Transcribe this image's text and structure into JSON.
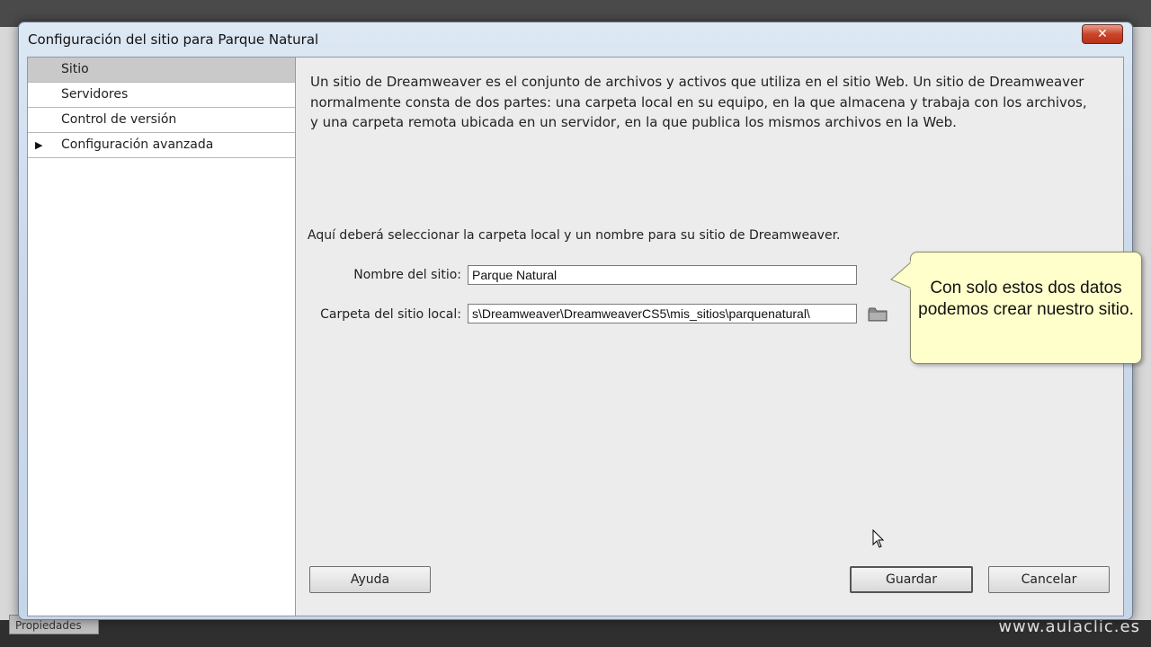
{
  "background": {
    "properties_tab": "Propiedades",
    "watermark": "www.aulaclic.es"
  },
  "dialog": {
    "title": "Configuración del sitio para Parque Natural",
    "close_glyph": "✕"
  },
  "nav": {
    "items": [
      {
        "label": "Sitio",
        "selected": true
      },
      {
        "label": "Servidores"
      },
      {
        "label": "Control de versión"
      },
      {
        "label": "Configuración avanzada",
        "expandable": true
      }
    ],
    "arrow_glyph": "▶"
  },
  "main": {
    "description": "Un sitio de Dreamweaver es el conjunto de archivos y activos que utiliza en el sitio Web. Un sitio de Dreamweaver normalmente consta de dos partes: una carpeta local en su equipo, en la que almacena y trabaja con los archivos, y una carpeta remota ubicada en un servidor, en la que publica los mismos archivos en la Web.",
    "instruction": "Aquí deberá seleccionar la carpeta local y un nombre para su sitio de Dreamweaver.",
    "site_name_label": "Nombre del sitio:",
    "site_name_value": "Parque Natural",
    "local_folder_label": "Carpeta del sitio local:",
    "local_folder_value": "s\\Dreamweaver\\DreamweaverCS5\\mis_sitios\\parquenatural\\"
  },
  "buttons": {
    "help": "Ayuda",
    "save": "Guardar",
    "cancel": "Cancelar"
  },
  "callout": {
    "text": "Con solo estos dos datos podemos crear nuestro sitio."
  }
}
